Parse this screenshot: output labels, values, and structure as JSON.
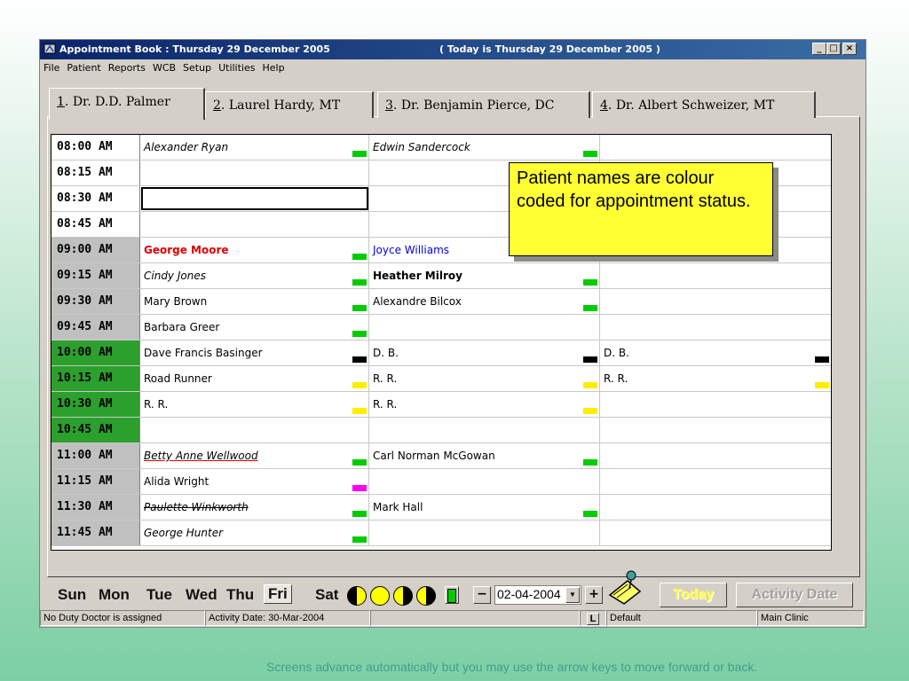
{
  "window": {
    "title": "Appointment Book : Thursday 29 December 2005",
    "today_text": "( Today is Thursday 29 December 2005 )",
    "minimize": "_",
    "maximize": "□",
    "close": "×"
  },
  "menu": [
    "File",
    "Patient",
    "Reports",
    "WCB",
    "Setup",
    "Utilities",
    "Help"
  ],
  "tabs": [
    {
      "key": "1",
      "rest": ". Dr. D.D. Palmer",
      "active": true
    },
    {
      "key": "2",
      "rest": ". Laurel Hardy, MT",
      "active": false
    },
    {
      "key": "3",
      "rest": ". Dr. Benjamin Pierce, DC",
      "active": false
    },
    {
      "key": "4",
      "rest": ". Dr. Albert Schweizer, MT",
      "active": false
    }
  ],
  "rows": [
    {
      "time": "08:00 AM",
      "style": "white",
      "c1": {
        "name": "Alexander Ryan",
        "fmt": "italic",
        "marker": "#00cc00"
      },
      "c2": {
        "name": "Edwin Sandercock",
        "fmt": "italic",
        "marker": "#00cc00"
      },
      "c3": null
    },
    {
      "time": "08:15 AM",
      "style": "white",
      "c1": null,
      "c2": null,
      "c3": null
    },
    {
      "time": "08:30 AM",
      "style": "white",
      "c1": {
        "name": "",
        "fmt": "selected",
        "marker": null
      },
      "c2": null,
      "c3": null
    },
    {
      "time": "08:45 AM",
      "style": "white",
      "c1": null,
      "c2": null,
      "c3": null
    },
    {
      "time": "09:00 AM",
      "style": "gray",
      "c1": {
        "name": "George Moore",
        "fmt": "bold red",
        "marker": "#00cc00"
      },
      "c2": {
        "name": "Joyce Williams",
        "fmt": "blue",
        "marker": "#00cc00"
      },
      "c3": null
    },
    {
      "time": "09:15 AM",
      "style": "gray",
      "c1": {
        "name": "Cindy Jones",
        "fmt": "italic",
        "marker": "#00cc00"
      },
      "c2": {
        "name": "Heather Milroy",
        "fmt": "bold",
        "marker": "#00cc00"
      },
      "c3": null
    },
    {
      "time": "09:30 AM",
      "style": "gray",
      "c1": {
        "name": "Mary Brown",
        "fmt": "",
        "marker": "#00cc00"
      },
      "c2": {
        "name": "Alexandre Bilcox",
        "fmt": "",
        "marker": "#00cc00"
      },
      "c3": null
    },
    {
      "time": "09:45 AM",
      "style": "gray",
      "c1": {
        "name": "Barbara Greer",
        "fmt": "",
        "marker": "#00cc00"
      },
      "c2": null,
      "c3": null
    },
    {
      "time": "10:00 AM",
      "style": "green",
      "c1": {
        "name": "Dave Francis Basinger",
        "fmt": "",
        "marker": "#000000"
      },
      "c2": {
        "name": "D. B.",
        "fmt": "",
        "marker": "#000000"
      },
      "c3": {
        "name": "D. B.",
        "fmt": "",
        "marker": "#000000"
      }
    },
    {
      "time": "10:15 AM",
      "style": "green",
      "c1": {
        "name": "Road Runner",
        "fmt": "",
        "marker": "#ffee00"
      },
      "c2": {
        "name": "R. R.",
        "fmt": "",
        "marker": "#ffee00"
      },
      "c3": {
        "name": "R. R.",
        "fmt": "",
        "marker": "#ffee00"
      }
    },
    {
      "time": "10:30 AM",
      "style": "green",
      "c1": {
        "name": "R. R.",
        "fmt": "",
        "marker": "#ffee00"
      },
      "c2": {
        "name": "R. R.",
        "fmt": "",
        "marker": "#ffee00"
      },
      "c3": null
    },
    {
      "time": "10:45 AM",
      "style": "green",
      "c1": null,
      "c2": null,
      "c3": null
    },
    {
      "time": "11:00 AM",
      "style": "gray",
      "c1": {
        "name": "Betty Anne Wellwood",
        "fmt": "italic underline-red",
        "marker": "#00cc00"
      },
      "c2": {
        "name": "Carl Norman McGowan",
        "fmt": "",
        "marker": "#00cc00"
      },
      "c3": null
    },
    {
      "time": "11:15 AM",
      "style": "gray",
      "c1": {
        "name": "Alida Wright",
        "fmt": "",
        "marker": "#ff00ff"
      },
      "c2": null,
      "c3": null
    },
    {
      "time": "11:30 AM",
      "style": "gray",
      "c1": {
        "name": "Paulette Winkworth",
        "fmt": "italic strike",
        "marker": "#00cc00"
      },
      "c2": {
        "name": "Mark Hall",
        "fmt": "",
        "marker": "#00cc00"
      },
      "c3": null
    },
    {
      "time": "11:45 AM",
      "style": "gray",
      "c1": {
        "name": "George Hunter",
        "fmt": "italic",
        "marker": "#00cc00"
      },
      "c2": null,
      "c3": null
    }
  ],
  "callout": "Patient names are colour coded for appointment status.",
  "days": {
    "sun": "Sun",
    "mon": "Mon",
    "tue": "Tue",
    "wed": "Wed",
    "thu": "Thu",
    "fri": "Fri",
    "sat": "Sat"
  },
  "date_value": "02-04-2004",
  "minus": "−",
  "plus": "+",
  "today_button": "Today",
  "activity_date_button": "Activity Date",
  "status": {
    "duty": "No Duty Doctor is assigned",
    "activity": "Activity Date: 30-Mar-2004",
    "l_label": "L",
    "profile": "Default",
    "clinic": "Main Clinic"
  },
  "footer": "Screens advance automatically but you may use the arrow keys to move forward or back."
}
